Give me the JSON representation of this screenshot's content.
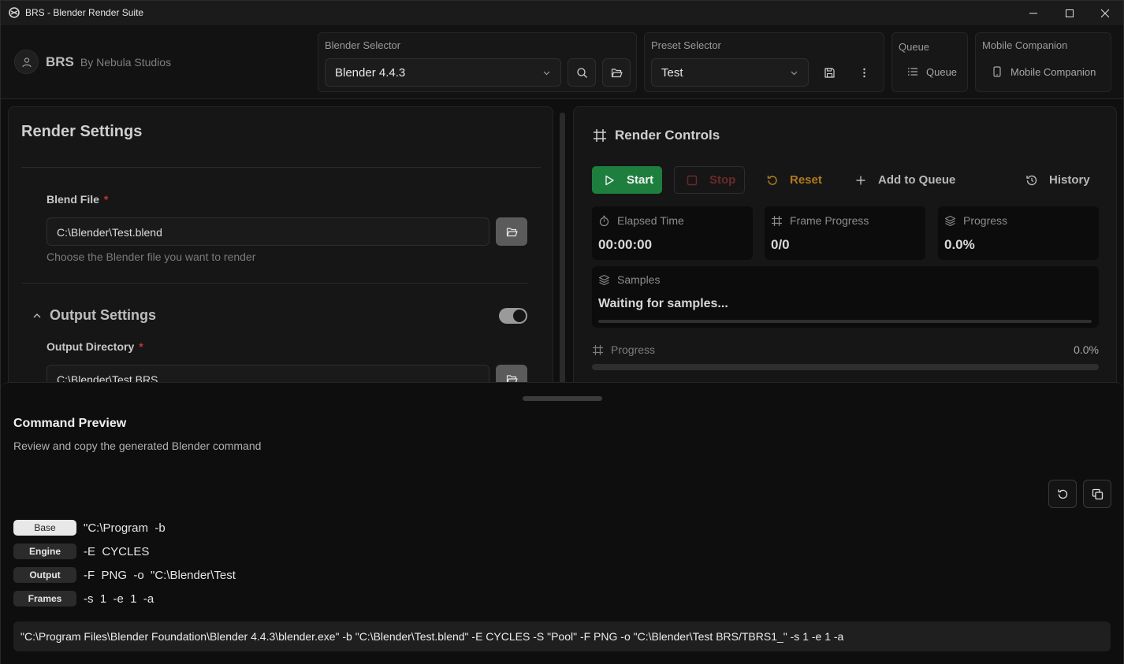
{
  "window": {
    "title": "BRS - Blender Render Suite"
  },
  "brand": {
    "name": "BRS",
    "subtitle": "By Nebula Studios"
  },
  "header": {
    "blender_selector": {
      "label": "Blender Selector",
      "value": "Blender 4.4.3"
    },
    "preset_selector": {
      "label": "Preset Selector",
      "value": "Test"
    },
    "queue": {
      "label": "Queue",
      "button": "Queue"
    },
    "mobile": {
      "label": "Mobile Companion",
      "button": "Mobile Companion"
    }
  },
  "render_settings": {
    "title": "Render Settings",
    "blend_file": {
      "label": "Blend File",
      "required_mark": "*",
      "value": "C:\\Blender\\Test.blend",
      "hint": "Choose the Blender file you want to render"
    },
    "output_settings": {
      "title": "Output Settings",
      "enabled": true,
      "output_directory": {
        "label": "Output Directory",
        "required_mark": "*",
        "value": "C:\\Blender\\Test BRS"
      }
    }
  },
  "render_controls": {
    "title": "Render Controls",
    "buttons": {
      "start": "Start",
      "stop": "Stop",
      "reset": "Reset",
      "add_to_queue": "Add to Queue",
      "history": "History"
    },
    "stats": {
      "elapsed": {
        "label": "Elapsed Time",
        "value": "00:00:00"
      },
      "frame_progress": {
        "label": "Frame Progress",
        "value": "0/0"
      },
      "progress": {
        "label": "Progress",
        "value": "0.0%"
      }
    },
    "samples": {
      "label": "Samples",
      "status": "Waiting for samples...",
      "fraction": 0
    },
    "overall_progress": {
      "label": "Progress",
      "value": "0.0%",
      "fraction": 0
    }
  },
  "command_preview": {
    "title": "Command Preview",
    "subtitle": "Review and copy the generated Blender command",
    "rows": [
      {
        "tag": "Base",
        "text": "\"C:\\Program  -b",
        "active": true
      },
      {
        "tag": "Engine",
        "text": "-E  CYCLES",
        "active": false
      },
      {
        "tag": "Output",
        "text": "-F  PNG  -o  \"C:\\Blender\\Test",
        "active": false
      },
      {
        "tag": "Frames",
        "text": "-s  1  -e  1  -a",
        "active": false
      }
    ],
    "full_command": "\"C:\\Program Files\\Blender Foundation\\Blender 4.4.3\\blender.exe\" -b \"C:\\Blender\\Test.blend\" -E CYCLES -S \"Pool\" -F PNG -o \"C:\\Blender\\Test BRS/TBRS1_\" -s 1 -e 1 -a"
  },
  "colors": {
    "accent_green": "#1e7e3e",
    "reset_orange": "#b07a1e",
    "required_red": "#c0392b"
  }
}
